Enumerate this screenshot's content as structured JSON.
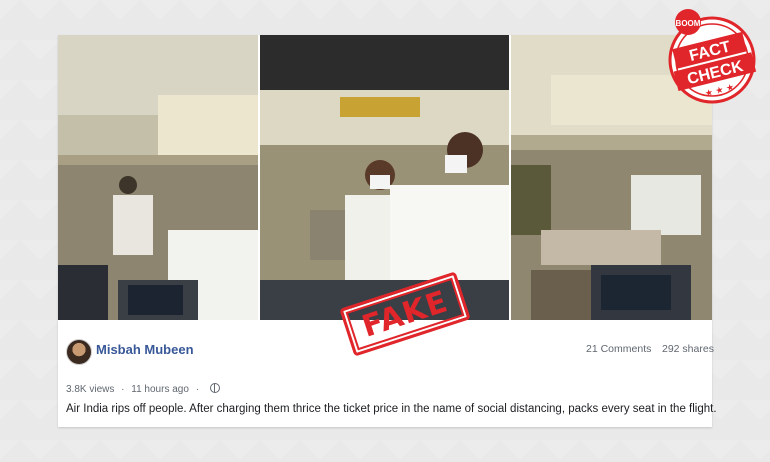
{
  "post": {
    "author": "Misbah Mubeen",
    "comments": "21 Comments",
    "shares": "292 shares",
    "views": "3.8K views",
    "time": "11 hours ago",
    "caption": "Air India rips off people. After charging them thrice the ticket price in the name of social distancing, packs every seat in the flight."
  },
  "stamp": {
    "label": "FAKE"
  },
  "badge": {
    "brand": "BOOM",
    "line1": "FACT",
    "line2": "CHECK"
  },
  "colors": {
    "stamp_red": "#e0262a",
    "author_blue": "#385898",
    "cabin_beige": "#d8d0b8"
  }
}
